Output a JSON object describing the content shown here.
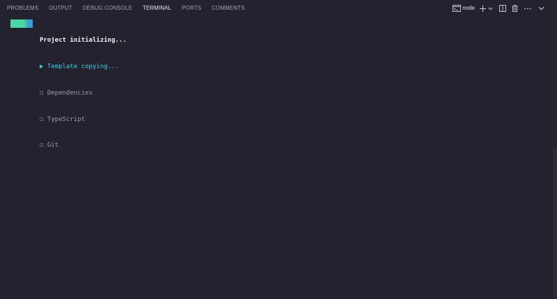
{
  "tabs": [
    {
      "label": "PROBLEMS"
    },
    {
      "label": "OUTPUT"
    },
    {
      "label": "DEBUG CONSOLE"
    },
    {
      "label": "TERMINAL",
      "active": true
    },
    {
      "label": "PORTS"
    },
    {
      "label": "COMMENTS"
    }
  ],
  "toolbar": {
    "shell_label": "node",
    "icons": [
      "terminal-icon",
      "plus-icon",
      "chevron-down-icon",
      "split-icon",
      "trash-icon",
      "ellipsis-icon",
      "chevron-down-icon"
    ]
  },
  "terminal": {
    "title": "Project initializing...",
    "steps": [
      {
        "marker": "▶",
        "label": "Template copying...",
        "state": "active"
      },
      {
        "marker": "◻",
        "label": "Dependencies",
        "state": "pending"
      },
      {
        "marker": "◻",
        "label": "TypeScript",
        "state": "pending"
      },
      {
        "marker": "◻",
        "label": "Git",
        "state": "pending"
      }
    ]
  },
  "colors": {
    "background": "#24222f",
    "active_step": "#38d1e8",
    "badge": [
      "#4ad9a4",
      "#3fb8b0",
      "#3a9bd6"
    ]
  }
}
